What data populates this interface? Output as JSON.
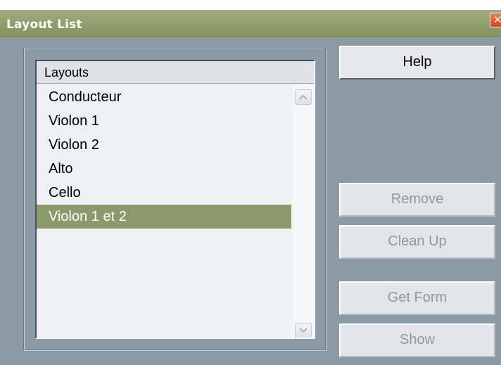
{
  "window": {
    "title": "Layout List",
    "close_icon": "close-icon"
  },
  "list": {
    "header": "Layouts",
    "items": [
      {
        "label": "Conducteur",
        "selected": false
      },
      {
        "label": "Violon 1",
        "selected": false
      },
      {
        "label": "Violon 2",
        "selected": false
      },
      {
        "label": "Alto",
        "selected": false
      },
      {
        "label": "Cello",
        "selected": false
      },
      {
        "label": "Violon 1 et 2",
        "selected": true
      }
    ],
    "selected_color": "#8b9a6a"
  },
  "buttons": {
    "help": "Help",
    "remove": "Remove",
    "clean_up": "Clean Up",
    "get_form": "Get Form",
    "show": "Show"
  },
  "colors": {
    "window_bg": "#8c9aa6",
    "titlebar": "#93a070",
    "close": "#d9441c"
  }
}
